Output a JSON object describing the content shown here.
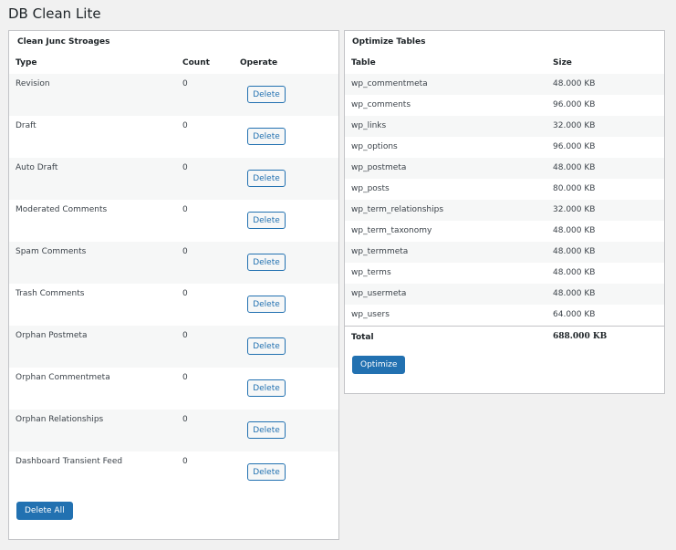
{
  "page": {
    "title": "DB Clean Lite"
  },
  "clean": {
    "title": "Clean Junc Stroages",
    "headers": {
      "type": "Type",
      "count": "Count",
      "operate": "Operate"
    },
    "rows": [
      {
        "type": "Revision",
        "count": "0",
        "button": "Delete"
      },
      {
        "type": "Draft",
        "count": "0",
        "button": "Delete"
      },
      {
        "type": "Auto Draft",
        "count": "0",
        "button": "Delete"
      },
      {
        "type": "Moderated Comments",
        "count": "0",
        "button": "Delete"
      },
      {
        "type": "Spam Comments",
        "count": "0",
        "button": "Delete"
      },
      {
        "type": "Trash Comments",
        "count": "0",
        "button": "Delete"
      },
      {
        "type": "Orphan Postmeta",
        "count": "0",
        "button": "Delete"
      },
      {
        "type": "Orphan Commentmeta",
        "count": "0",
        "button": "Delete"
      },
      {
        "type": "Orphan Relationships",
        "count": "0",
        "button": "Delete"
      },
      {
        "type": "Dashboard Transient Feed",
        "count": "0",
        "button": "Delete"
      }
    ],
    "delete_all_label": "Delete All"
  },
  "optimize": {
    "title": "Optimize Tables",
    "headers": {
      "table": "Table",
      "size": "Size"
    },
    "rows": [
      {
        "table": "wp_commentmeta",
        "size": "48.000 KB"
      },
      {
        "table": "wp_comments",
        "size": "96.000 KB"
      },
      {
        "table": "wp_links",
        "size": "32.000 KB"
      },
      {
        "table": "wp_options",
        "size": "96.000 KB"
      },
      {
        "table": "wp_postmeta",
        "size": "48.000 KB"
      },
      {
        "table": "wp_posts",
        "size": "80.000 KB"
      },
      {
        "table": "wp_term_relationships",
        "size": "32.000 KB"
      },
      {
        "table": "wp_term_taxonomy",
        "size": "48.000 KB"
      },
      {
        "table": "wp_termmeta",
        "size": "48.000 KB"
      },
      {
        "table": "wp_terms",
        "size": "48.000 KB"
      },
      {
        "table": "wp_usermeta",
        "size": "48.000 KB"
      },
      {
        "table": "wp_users",
        "size": "64.000 KB"
      }
    ],
    "total_label": "Total",
    "total_size": "688.000 KB",
    "button_label": "Optimize"
  }
}
